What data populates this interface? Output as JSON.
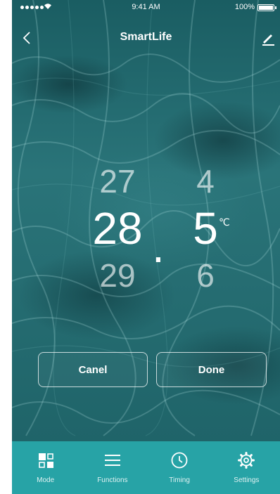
{
  "status_bar": {
    "time": "9:41 AM",
    "battery": "100%"
  },
  "nav": {
    "title": "SmartLife",
    "back_icon": "chevron-left-icon",
    "edit_icon": "pencil-icon"
  },
  "picker": {
    "integer": {
      "above": "27",
      "selected": "28",
      "below": "29"
    },
    "decimal": {
      "above": "4",
      "selected": "5",
      "below": "6"
    },
    "separator": ".",
    "unit": "℃"
  },
  "buttons": {
    "cancel": "Canel",
    "done": "Done"
  },
  "tabs": [
    {
      "label": "Mode",
      "icon": "grid-icon"
    },
    {
      "label": "Functions",
      "icon": "menu-icon"
    },
    {
      "label": "Timing",
      "icon": "clock-icon"
    },
    {
      "label": "Settings",
      "icon": "gear-icon"
    }
  ],
  "colors": {
    "tabbar": "#27a3a6",
    "background": "#1f6469"
  }
}
